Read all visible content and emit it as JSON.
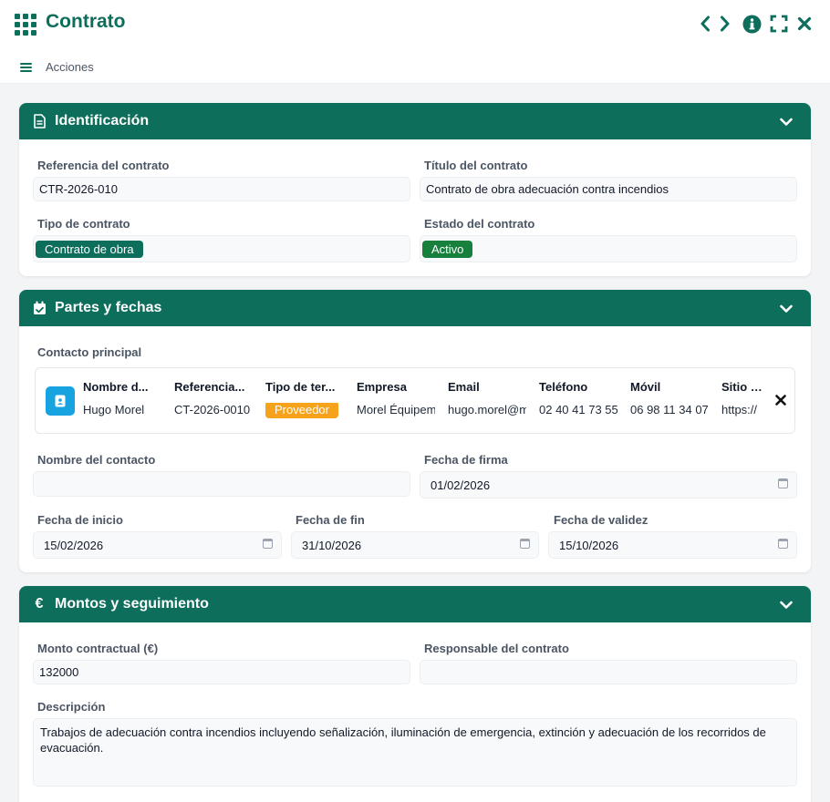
{
  "header": {
    "title": "Contrato",
    "icons": [
      "grid-icon",
      "chevron-left-icon",
      "chevron-right-icon",
      "info-icon",
      "fullscreen-icon",
      "close-icon"
    ],
    "menu_label": "Acciones"
  },
  "colors": {
    "primary": "#0d6e5c",
    "active_badge": "#16803c",
    "supplier_badge": "#f6a21a",
    "avatar": "#17a2e0"
  },
  "identificacion": {
    "title": "Identificación",
    "icon": "document-icon",
    "ref_label": "Referencia del contrato",
    "ref_value": "CTR-2026-010",
    "titulo_label": "Título del contrato",
    "titulo_value": "Contrato de obra adecuación contra incendios",
    "tipo_label": "Tipo de contrato",
    "tipo_value": "Contrato de obra",
    "estado_label": "Estado del contrato",
    "estado_value": "Activo"
  },
  "partes": {
    "title": "Partes y fechas",
    "icon": "calendar-check-icon",
    "contacto_label": "Contacto principal",
    "contact": {
      "columns": [
        {
          "header": "Nombre d...",
          "value": "Hugo Morel"
        },
        {
          "header": "Referencia...",
          "value": "CT-2026-0010"
        },
        {
          "header": "Tipo de ter...",
          "value": "Proveedor"
        },
        {
          "header": "Empresa",
          "value": "Morel Équipements"
        },
        {
          "header": "Email",
          "value": "hugo.morel@morel-equipements.fr"
        },
        {
          "header": "Teléfono",
          "value": "02 40 41 73 55"
        },
        {
          "header": "Móvil",
          "value": "06 98 11 34 07"
        },
        {
          "header": "Sitio we",
          "value": "https://"
        }
      ]
    },
    "nombre_contacto_label": "Nombre del contacto",
    "nombre_contacto_value": "",
    "fecha_firma_label": "Fecha de firma",
    "fecha_firma_value": "01/02/2026",
    "fecha_inicio_label": "Fecha de inicio",
    "fecha_inicio_value": "15/02/2026",
    "fecha_fin_label": "Fecha de fin",
    "fecha_fin_value": "31/10/2026",
    "fecha_validez_label": "Fecha de validez",
    "fecha_validez_value": "15/10/2026"
  },
  "montos": {
    "title": "Montos y seguimiento",
    "icon": "euro-icon",
    "monto_label": "Monto contractual (€)",
    "monto_value": "132000",
    "responsable_label": "Responsable del contrato",
    "responsable_value": "",
    "descripcion_label": "Descripción",
    "descripcion_value": "Trabajos de adecuación contra incendios incluyendo señalización, iluminación de emergencia, extinción y adecuación de los recorridos de evacuación."
  }
}
